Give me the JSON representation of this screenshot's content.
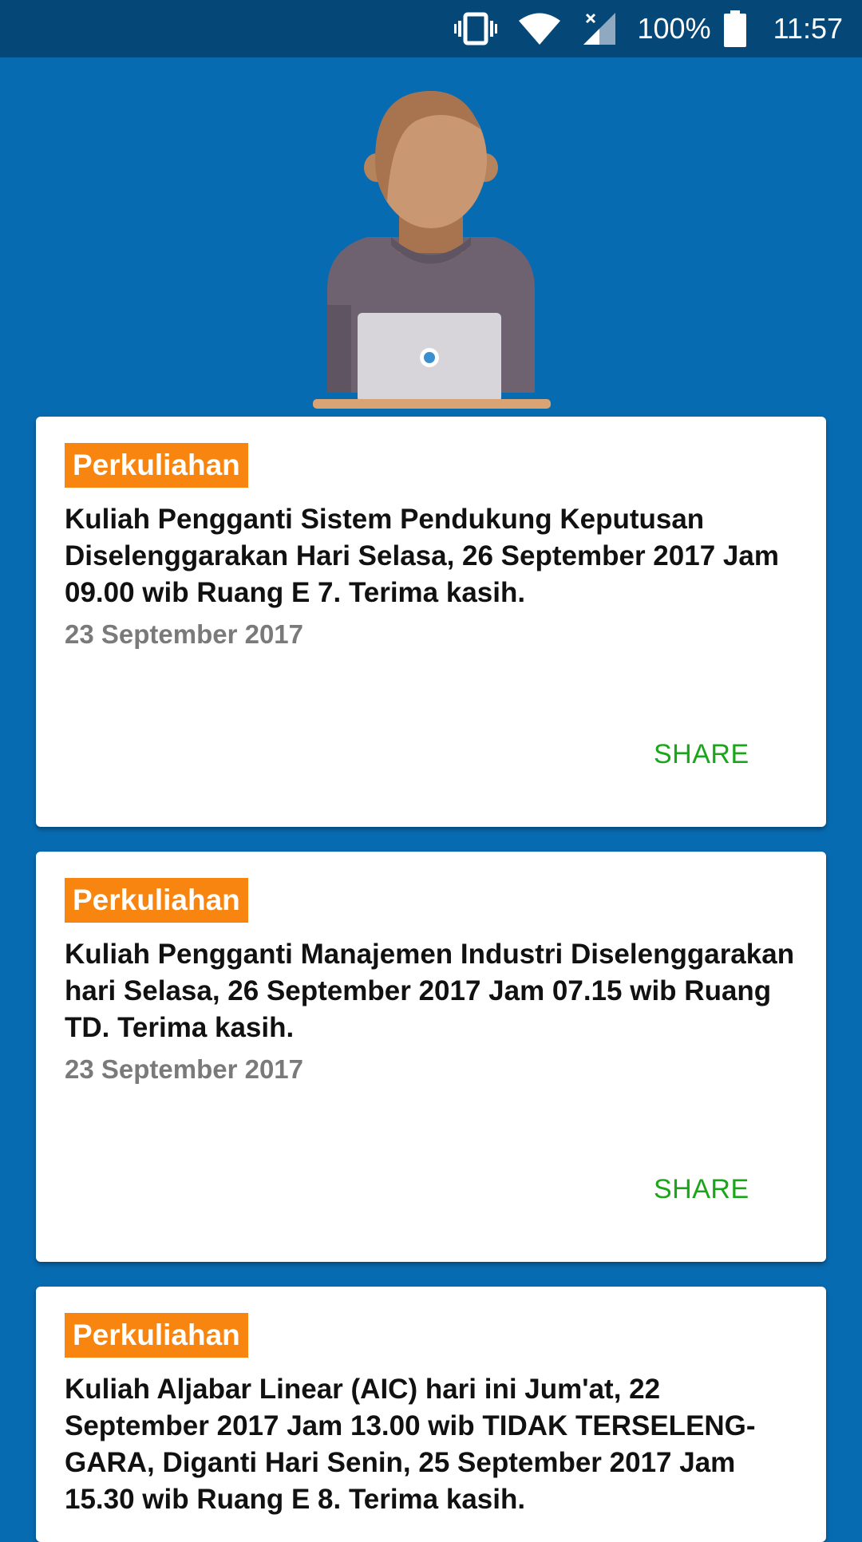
{
  "status_bar": {
    "icons": [
      "vibrate-icon",
      "wifi-icon",
      "no-signal-icon",
      "battery-icon"
    ],
    "battery_percent": "100%",
    "time": "11:57"
  },
  "colors": {
    "background": "#076bb1",
    "status_bar": "#054878",
    "tag": "#f7850f",
    "share": "#1aa51a",
    "date": "#7a7a7a"
  },
  "announcements": [
    {
      "tag": "Perkuliahan",
      "message": "Kuliah Pengganti Sistem Pendukung Keputusan Diselenggarakan Hari Selasa, 26 September 2017 Jam 09.00 wib Ruang E 7. Terima kasih.",
      "date": "23 September 2017",
      "share_label": "SHARE"
    },
    {
      "tag": "Perkuliahan",
      "message": "Kuliah Pengganti Manajemen Industri Diselenggarakan hari Selasa, 26 September 2017 Jam 07.15 wib Ruang TD. Terima kasih.",
      "date": "23 September 2017",
      "share_label": "SHARE"
    },
    {
      "tag": "Perkuliahan",
      "message": "Kuliah Aljabar Linear (AIC) hari ini Jum'at, 22 September 2017 Jam 13.00 wib TIDAK TERSELENG-GARA, Diganti Hari Senin, 25 September 2017 Jam 15.30 wib Ruang E 8. Terima kasih."
    }
  ]
}
